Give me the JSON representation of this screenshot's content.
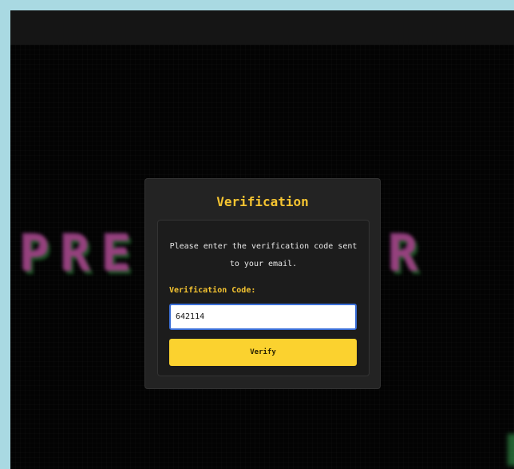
{
  "background_title": {
    "left": "PRE",
    "right": "AIR"
  },
  "modal": {
    "title": "Verification",
    "instructions": "Please enter the verification code sent to your email.",
    "code_label": "Verification Code:",
    "code_value": "642114",
    "verify_label": "Verify"
  },
  "colors": {
    "accent": "#f5c431",
    "button": "#fbd22f",
    "title_pink": "#ff6fd6",
    "title_shadow_green": "#2e8a3c",
    "input_border": "#3b6fd8"
  }
}
